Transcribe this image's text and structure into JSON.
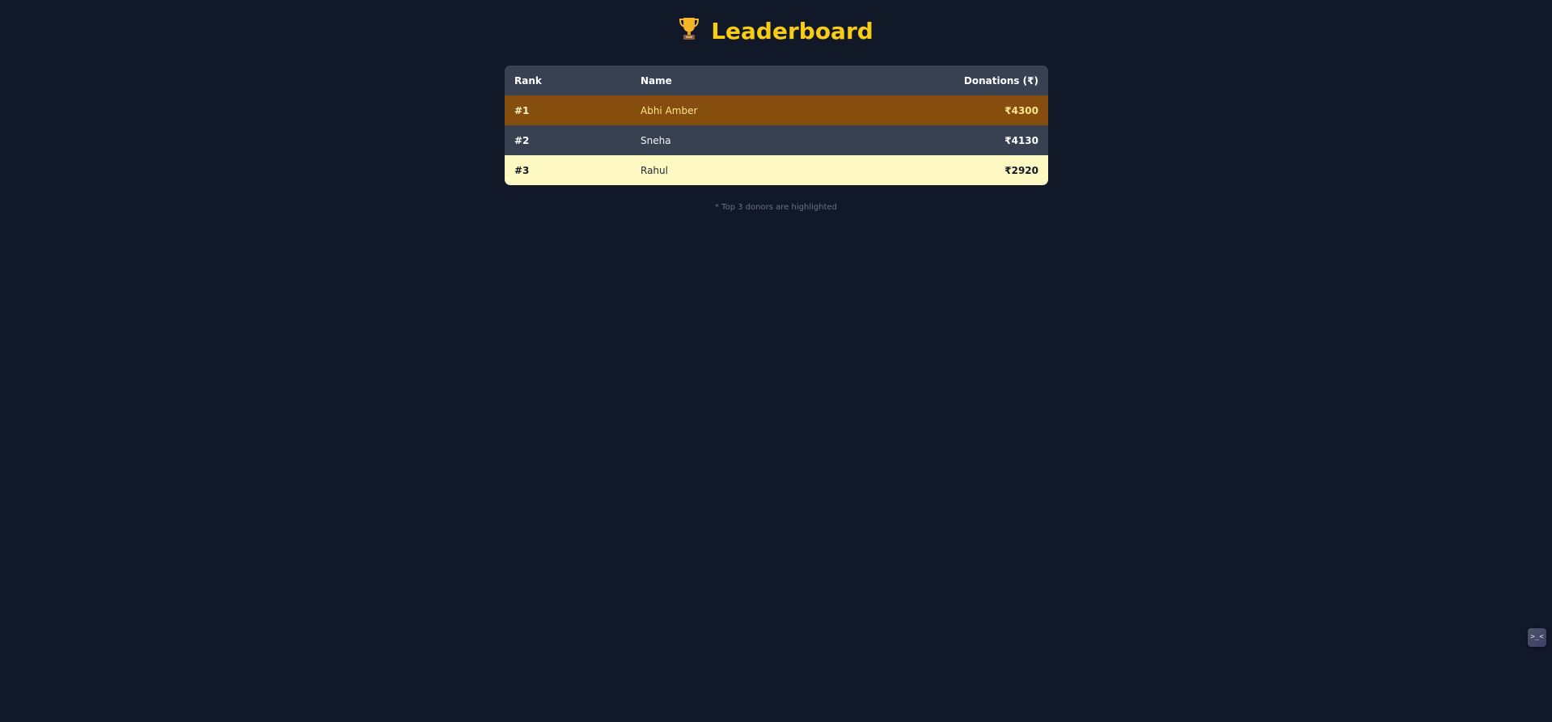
{
  "page": {
    "title": "Leaderboard",
    "title_icon": "trophy-icon",
    "accent_color": "#facc15"
  },
  "table": {
    "headers": {
      "rank": "Rank",
      "name": "Name",
      "donations": "Donations (₹)"
    },
    "rows": [
      {
        "rank": "#1",
        "name": "Abhi Amber",
        "donation": "₹4300"
      },
      {
        "rank": "#2",
        "name": "Sneha",
        "donation": "₹4130"
      },
      {
        "rank": "#3",
        "name": "Rahul",
        "donation": "₹2920"
      }
    ],
    "row_colors": [
      "#854d0e",
      "#374151",
      "#fef9c3"
    ]
  },
  "footer": {
    "note": "* Top 3 donors are highlighted"
  },
  "corner_button": {
    "icon": "devtools-icon",
    "glyph": ">_<"
  }
}
